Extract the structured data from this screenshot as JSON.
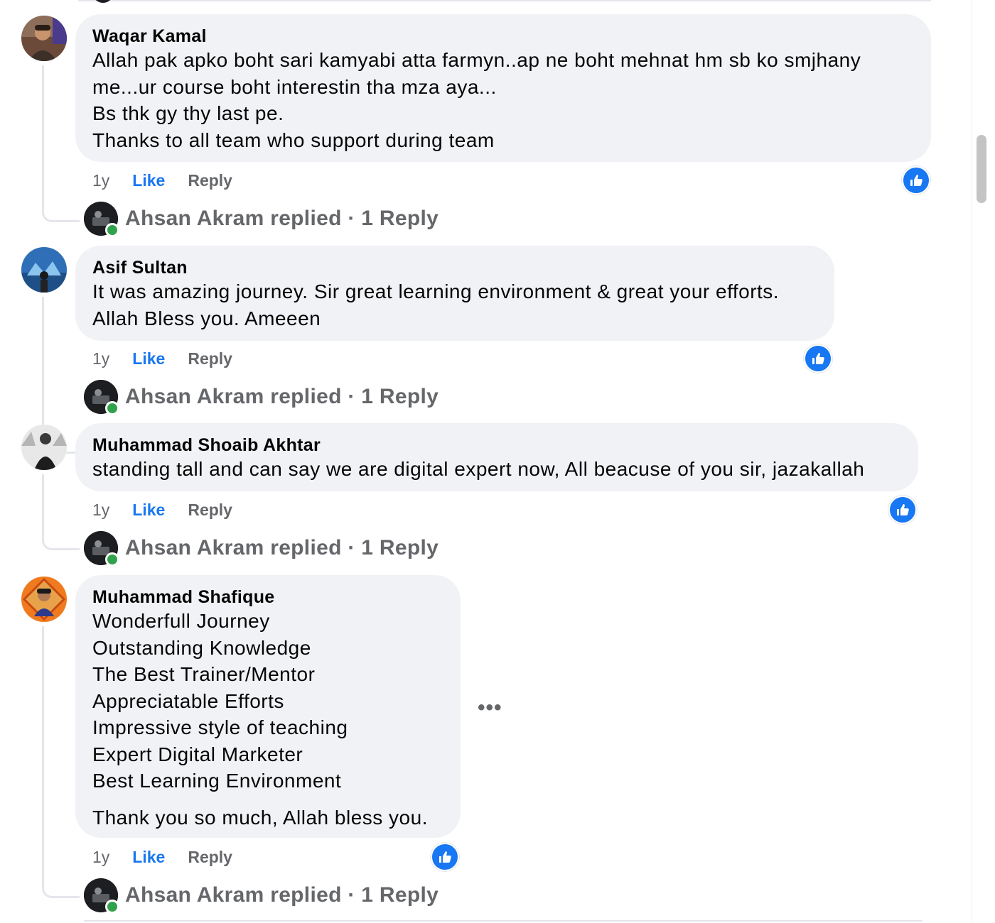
{
  "comments": [
    {
      "author": "Waqar Kamal",
      "text": "Allah pak apko boht sari kamyabi atta farmyn..ap ne boht mehnat hm sb ko smjhany\nme...ur course boht interestin tha mza aya...\nBs thk gy thy last pe.\nThanks to all team who support during team",
      "time": "1y",
      "like_label": "Like",
      "reply_label": "Reply",
      "replied_label": "Ahsan Akram replied · 1 Reply",
      "reaction": "like-reaction"
    },
    {
      "author": "Asif Sultan",
      "text": "It was amazing journey. Sir great learning environment & great your efforts.\nAllah Bless you. Ameeen",
      "time": "1y",
      "like_label": "Like",
      "reply_label": "Reply",
      "replied_label": "Ahsan Akram replied · 1 Reply",
      "reaction": "like-reaction"
    },
    {
      "author": "Muhammad Shoaib Akhtar",
      "text": "standing tall and can say we are digital expert now, All beacuse of you sir, jazakallah",
      "time": "1y",
      "like_label": "Like",
      "reply_label": "Reply",
      "replied_label": "Ahsan Akram replied · 1 Reply",
      "reaction": "like-reaction"
    },
    {
      "author": "Muhammad Shafique",
      "text": "Wonderfull Journey\nOutstanding Knowledge\nThe Best Trainer/Mentor\nAppreciatable Efforts\nImpressive style of teaching\nExpert Digital Marketer\nBest Learning Environment",
      "text_extra": "Thank you so much, Allah bless you.",
      "time": "1y",
      "like_label": "Like",
      "reply_label": "Reply",
      "replied_label": "Ahsan Akram replied · 1 Reply",
      "reaction": "like-reaction"
    }
  ],
  "more_options": "•••",
  "colors": {
    "bubble": "#f0f2f5",
    "like_blue": "#1877f2",
    "muted": "#65676b",
    "online": "#31a24c"
  }
}
